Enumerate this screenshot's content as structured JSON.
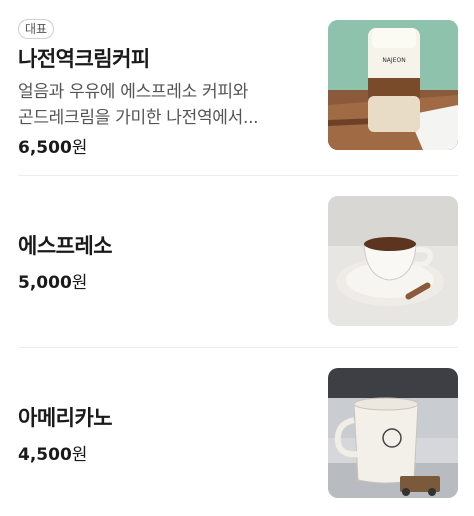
{
  "items": [
    {
      "badge": "대표",
      "name": "나전역크림커피",
      "desc_line1": "얼음과 우유에 에스프레소 커피와",
      "desc_line2": "곤드레크림을 가미한 나전역에서...",
      "price": "6,500",
      "currency": "원",
      "image_label": "iced cream coffee photo"
    },
    {
      "name": "에스프레소",
      "price": "5,000",
      "currency": "원",
      "image_label": "espresso cup photo"
    },
    {
      "name": "아메리카노",
      "price": "4,500",
      "currency": "원",
      "image_label": "americano mug photo"
    }
  ]
}
